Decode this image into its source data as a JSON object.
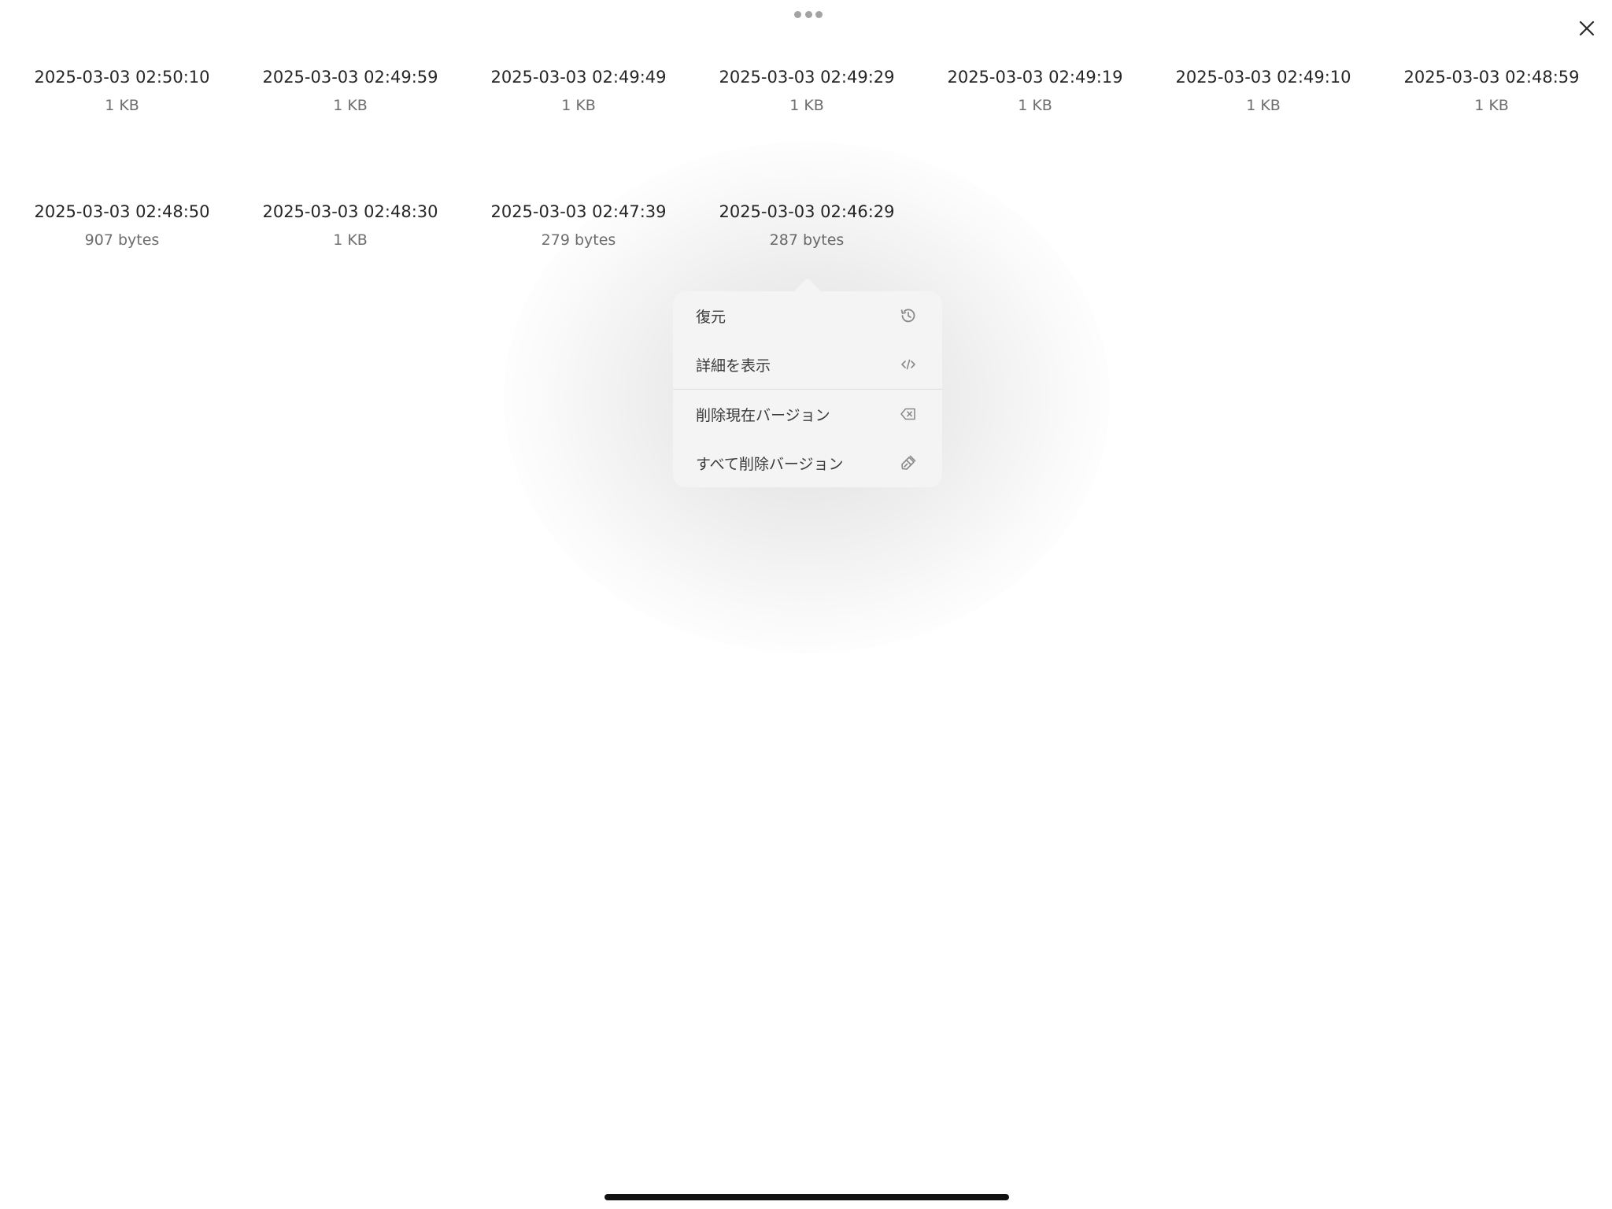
{
  "versions": [
    {
      "date": "2025-03-03 02:50:10",
      "size": "1 KB"
    },
    {
      "date": "2025-03-03 02:49:59",
      "size": "1 KB"
    },
    {
      "date": "2025-03-03 02:49:49",
      "size": "1 KB"
    },
    {
      "date": "2025-03-03 02:49:29",
      "size": "1 KB"
    },
    {
      "date": "2025-03-03 02:49:19",
      "size": "1 KB"
    },
    {
      "date": "2025-03-03 02:49:10",
      "size": "1 KB"
    },
    {
      "date": "2025-03-03 02:48:59",
      "size": "1 KB"
    },
    {
      "date": "2025-03-03 02:48:50",
      "size": "907 bytes"
    },
    {
      "date": "2025-03-03 02:48:30",
      "size": "1 KB"
    },
    {
      "date": "2025-03-03 02:47:39",
      "size": "279 bytes"
    },
    {
      "date": "2025-03-03 02:46:29",
      "size": "287 bytes"
    }
  ],
  "context_menu": {
    "items": [
      {
        "label": "復元",
        "icon": "history-icon"
      },
      {
        "label": "詳細を表示",
        "icon": "code-icon"
      },
      {
        "label": "削除現在バージョン",
        "icon": "delete-backspace-icon"
      },
      {
        "label": "すべて削除バージョン",
        "icon": "broom-icon"
      }
    ]
  },
  "icons": {
    "close": "close-icon",
    "grabber": "more-dots-icon"
  },
  "colors": {
    "background": "#ffffff",
    "menu_background": "#f4f4f4",
    "primary_text": "#262626",
    "secondary_text": "#6e6e6e",
    "icon": "#8a8a8a"
  }
}
